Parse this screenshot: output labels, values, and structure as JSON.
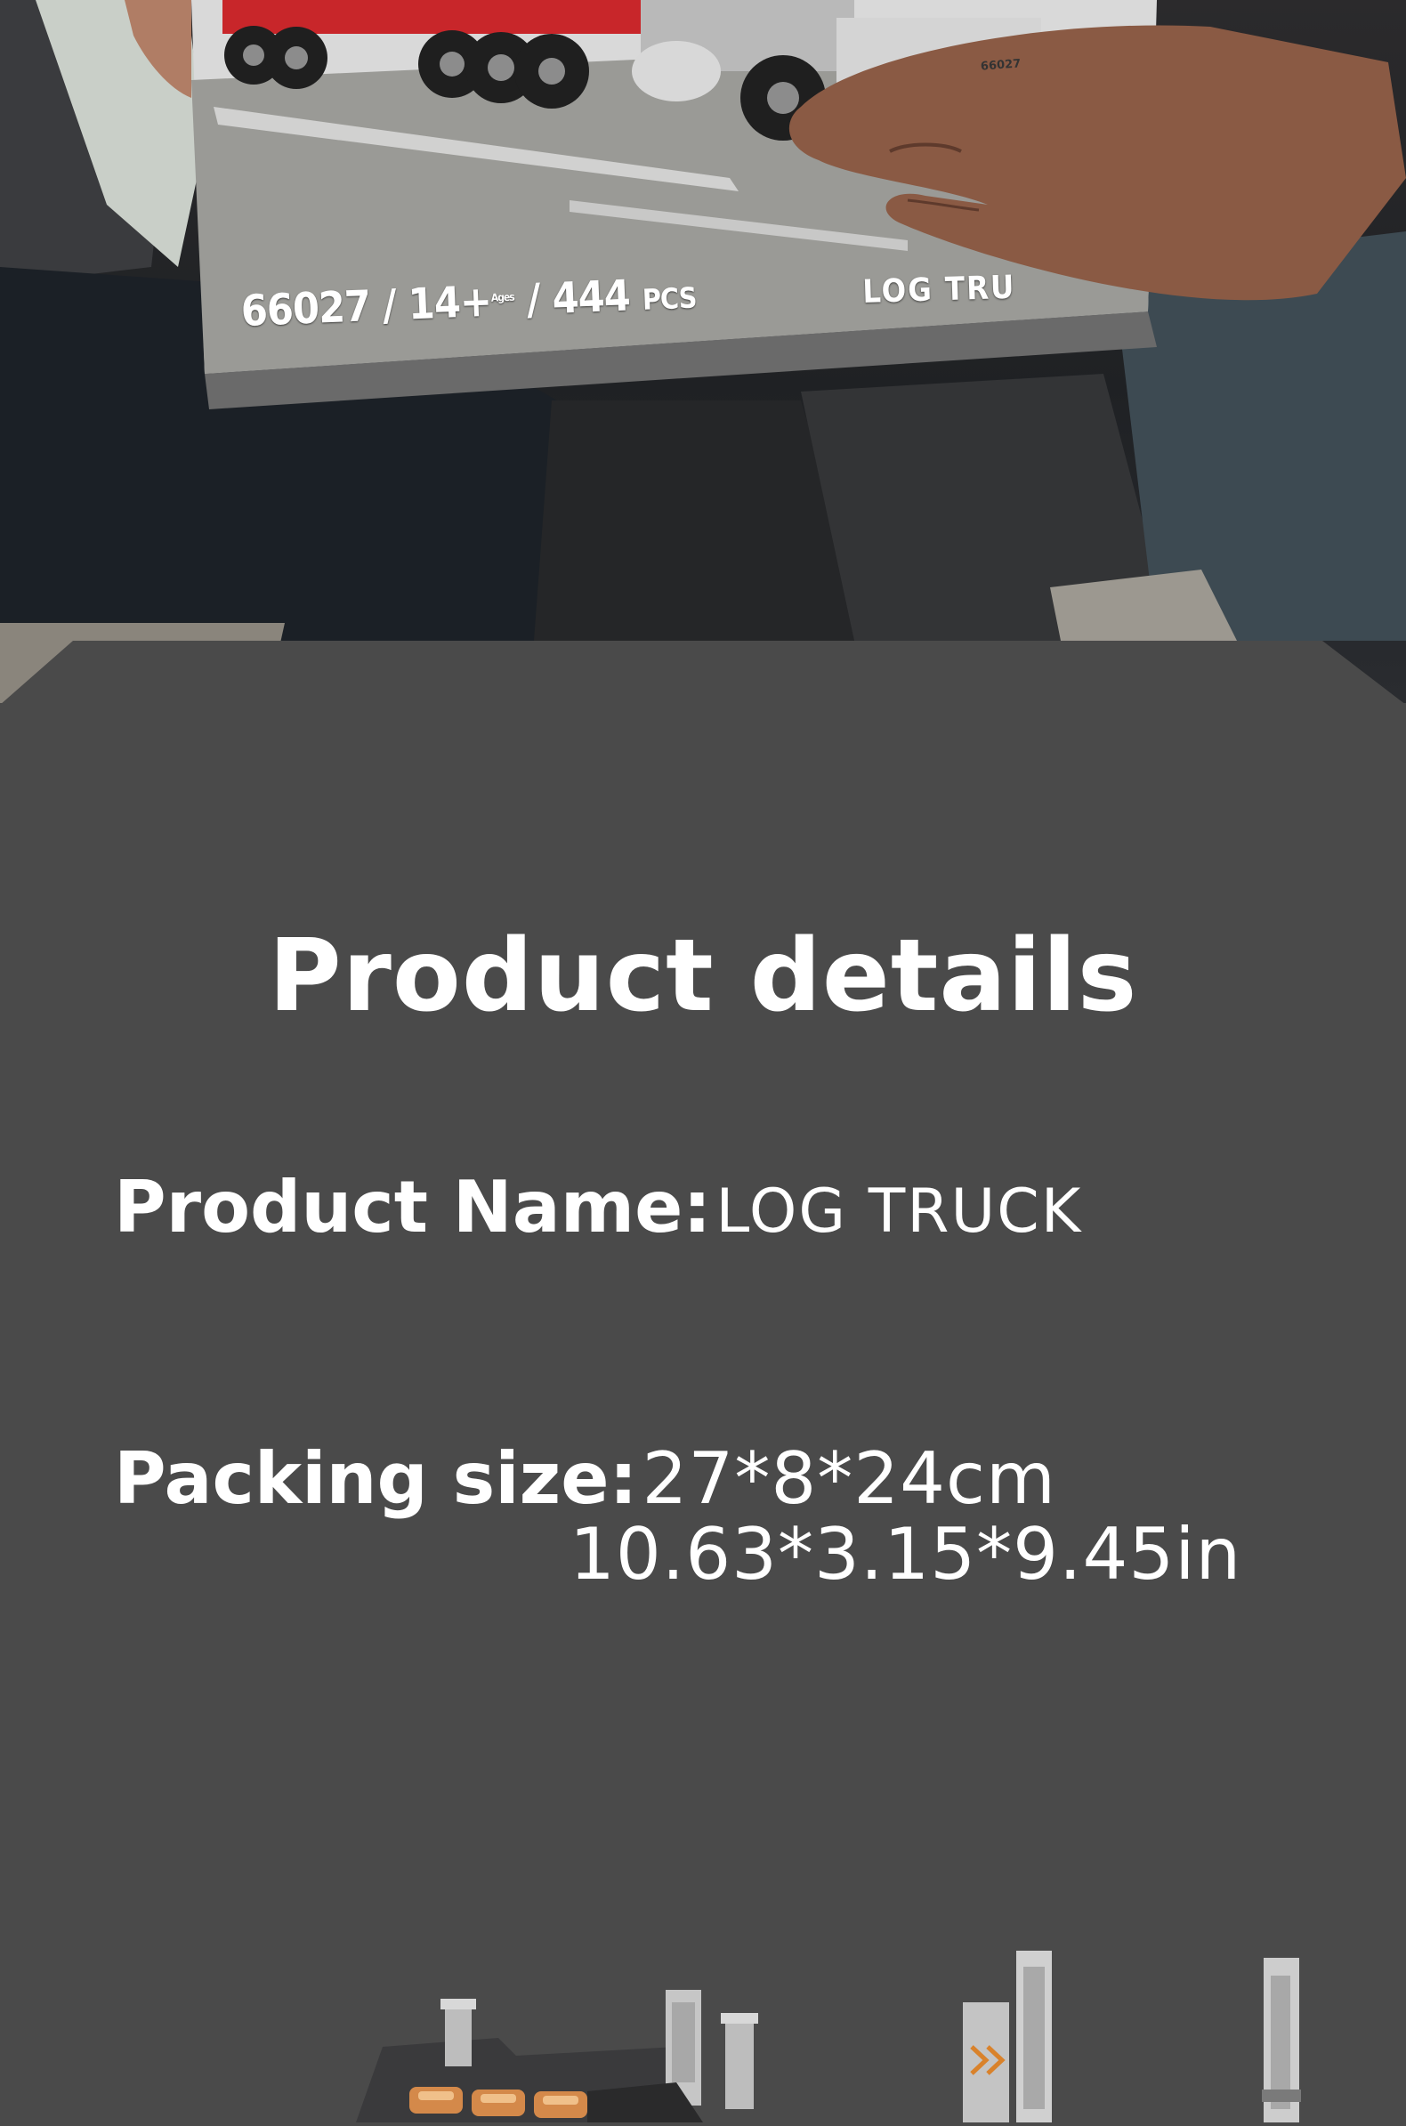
{
  "box": {
    "code": "66027",
    "age": "14+",
    "ages_word": "Ages",
    "pieces": "444",
    "pieces_unit": "PCS",
    "title": "LOG TRU",
    "mini_number": "66027"
  },
  "details": {
    "heading": "Product details",
    "name_label": "Product Name:",
    "name_value": "LOG  TRUCK",
    "size_label": "Packing size:",
    "size_metric": "27*8*24cm",
    "size_imperial": "10.63*3.15*9.45in"
  },
  "colors": {
    "panel": "#4a4a4a",
    "text": "#ffffff",
    "truck_accent": "#c8262a"
  }
}
